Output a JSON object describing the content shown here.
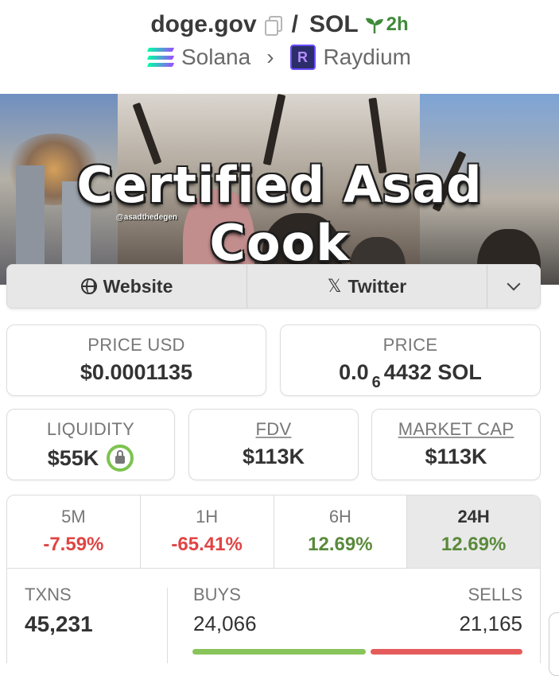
{
  "header": {
    "name": "doge.gov",
    "separator": "/",
    "quote": "SOL",
    "age": "2h",
    "chain": "Solana",
    "dex": "Raydium"
  },
  "banner": {
    "title": "Certified Asad Cook",
    "handle": "@asadthedegen"
  },
  "links": {
    "website": "Website",
    "twitter": "Twitter",
    "x_glyph": "𝕏"
  },
  "stats": {
    "price_usd_label": "PRICE USD",
    "price_usd": "$0.0001135",
    "price_label": "PRICE",
    "price_prefix": "0.0",
    "price_subscript": "6",
    "price_suffix": "4432 SOL",
    "liquidity_label": "LIQUIDITY",
    "liquidity": "$55K",
    "fdv_label": "FDV",
    "fdv": "$113K",
    "mcap_label": "MARKET CAP",
    "mcap": "$113K"
  },
  "periods": [
    {
      "label": "5M",
      "change": "-7.59%"
    },
    {
      "label": "1H",
      "change": "-65.41%"
    },
    {
      "label": "6H",
      "change": "12.69%"
    },
    {
      "label": "24H",
      "change": "12.69%"
    }
  ],
  "txns": {
    "label": "TXNS",
    "value": "45,231",
    "buys_label": "BUYS",
    "buys": "24,066",
    "sells_label": "SELLS",
    "sells": "21,165",
    "buy_ratio": 0.532
  },
  "colors": {
    "positive": "#5a8a3c",
    "negative": "#e04444",
    "buy_bar": "#88c45a",
    "sell_bar": "#e55b5b",
    "age_green": "#3f8a3a"
  },
  "icons": [
    "copy-icon",
    "sprout-icon",
    "solana-logo-icon",
    "chevron-right-icon",
    "raydium-logo-icon",
    "globe-icon",
    "x-logo-icon",
    "chevron-down-icon",
    "lock-icon"
  ]
}
